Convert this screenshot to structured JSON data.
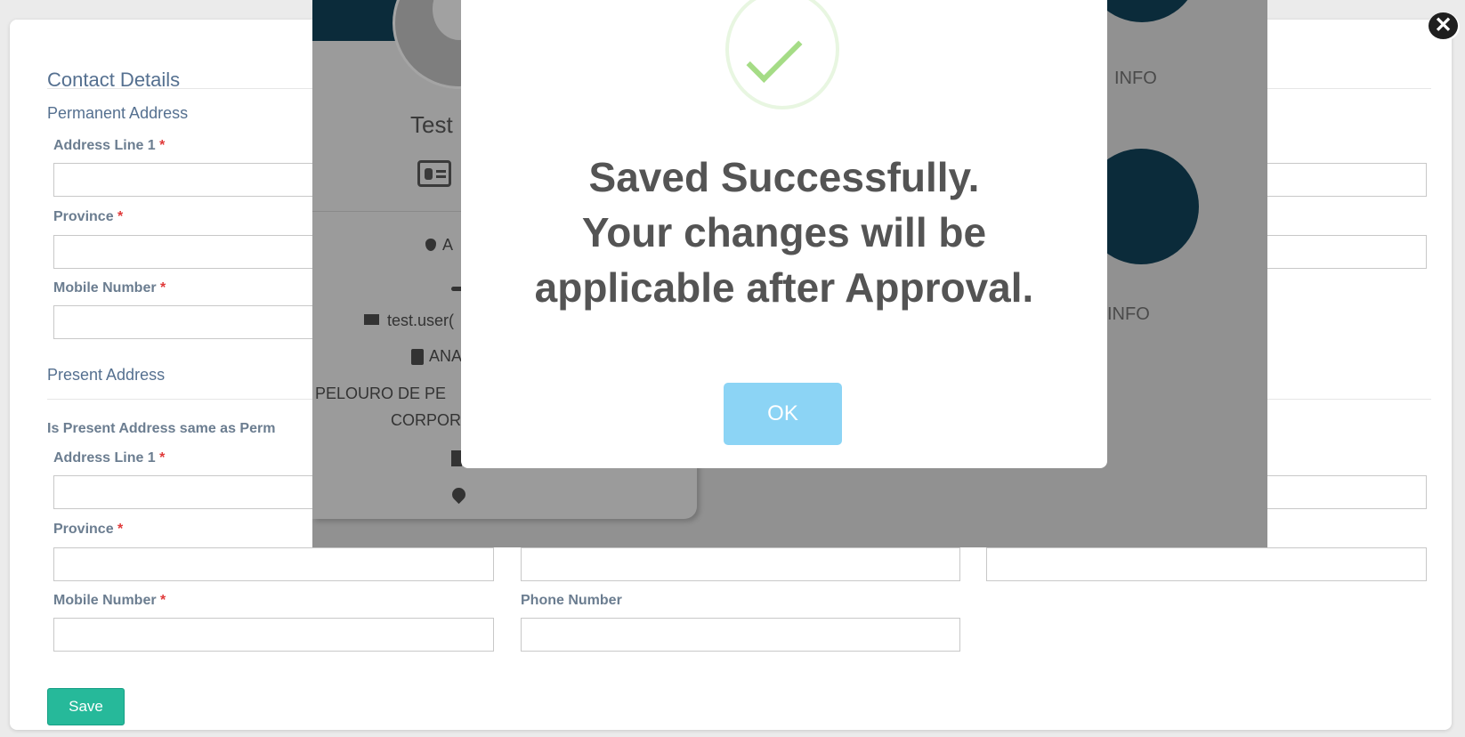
{
  "form": {
    "title": "Contact Details",
    "permanent_section": "Permanent Address",
    "present_section": "Present Address",
    "same_as_permanent_label": "Is Present Address same as Perm",
    "required_mark": "*",
    "permanent": {
      "address_line1_label": "Address Line 1",
      "province_label": "Province",
      "mobile_label": "Mobile Number"
    },
    "present": {
      "address_line1_label": "Address Line 1",
      "province_label": "Province",
      "mobile_label": "Mobile Number",
      "phone_label": "Phone Number"
    },
    "save_label": "Save",
    "close_glyph": "✕"
  },
  "profile": {
    "name": "Test",
    "blood_group": "A",
    "email": "test.user(",
    "id_text": "ANA",
    "department_line1": "PELOURO DE PE",
    "department_line2": "CORPOR",
    "info_label_1": "INFO",
    "info_label_2": "INFO"
  },
  "dialog": {
    "line1": "Saved Successfully.",
    "line2": "Your changes will be",
    "line3": "applicable after Approval.",
    "ok_label": "OK"
  },
  "colors": {
    "accent_green": "#26b99a",
    "check_green": "#a5dc86",
    "ok_blue": "#8cd4f5",
    "label_blue": "#557090",
    "required_red": "#e03a3a"
  }
}
